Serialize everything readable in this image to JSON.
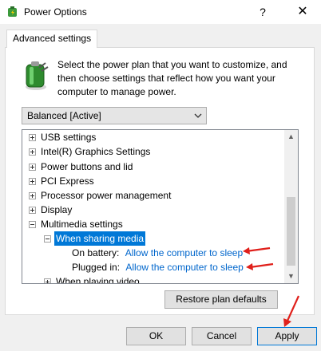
{
  "window": {
    "title": "Power Options",
    "help_glyph": "?",
    "close_glyph": "✕"
  },
  "tab": {
    "label": "Advanced settings"
  },
  "description": "Select the power plan that you want to customize, and then choose settings that reflect how you want your computer to manage power.",
  "plan_select": {
    "value": "Balanced [Active]"
  },
  "tree": {
    "items": [
      {
        "label": "USB settings",
        "expander": "plus"
      },
      {
        "label": "Intel(R) Graphics Settings",
        "expander": "plus"
      },
      {
        "label": "Power buttons and lid",
        "expander": "plus"
      },
      {
        "label": "PCI Express",
        "expander": "plus"
      },
      {
        "label": "Processor power management",
        "expander": "plus"
      },
      {
        "label": "Display",
        "expander": "plus"
      },
      {
        "label": "Multimedia settings",
        "expander": "minus"
      },
      {
        "label": "When sharing media",
        "expander": "minus",
        "selected": true
      },
      {
        "label": "On battery:",
        "value": "Allow the computer to sleep"
      },
      {
        "label": "Plugged in:",
        "value": "Allow the computer to sleep"
      },
      {
        "label": "When playing video",
        "expander": "plus"
      }
    ]
  },
  "buttons": {
    "restore": "Restore plan defaults",
    "ok": "OK",
    "cancel": "Cancel",
    "apply": "Apply"
  },
  "colors": {
    "selection": "#0078d7",
    "link": "#0066cc",
    "annotation_arrow": "#e0201b"
  }
}
